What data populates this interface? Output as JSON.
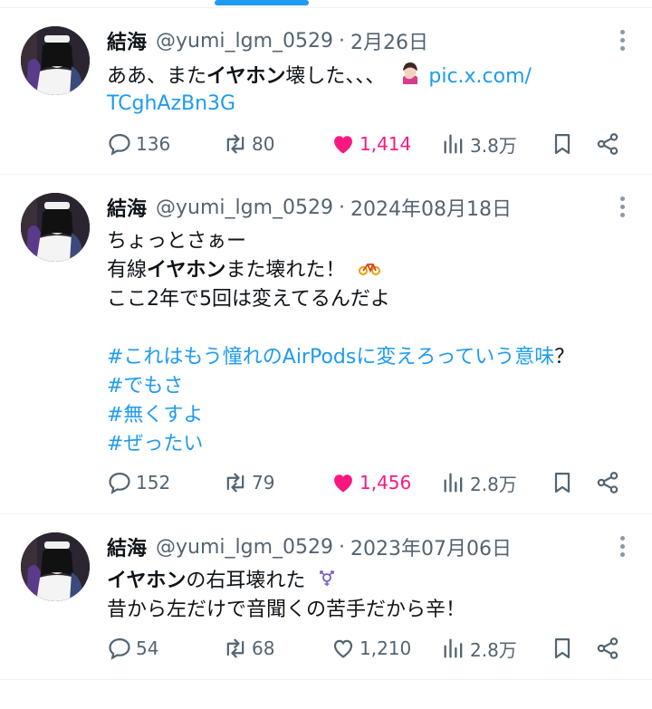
{
  "tweets": [
    {
      "name": "結海",
      "handle": "@yumi_lgm_0529",
      "separator": "·",
      "date": "2月26日",
      "text": {
        "line1_pre": "ああ、また",
        "line1_bold": "イヤホン",
        "line1_post": "壊した、、、",
        "link_part1": "pic.x.com/",
        "link_part2": "TCghAzBn3G"
      },
      "emoji": "woman-facepalming-emoji",
      "stats": {
        "replies": "136",
        "retweets": "80",
        "likes": "1,414",
        "views": "3.8万"
      },
      "liked": true
    },
    {
      "name": "結海",
      "handle": "@yumi_lgm_0529",
      "separator": "·",
      "date": "2024年08月18日",
      "text": {
        "line1": "ちょっとさぁー",
        "line2_pre": "有線",
        "line2_bold": "イヤホン",
        "line2_post": "また壊れた！",
        "line3": "ここ2年で5回は変えてるんだよ",
        "hashtag1": "#これはもう憧れのAirPodsに変えろっていう意味",
        "hashtag1_suffix": "？",
        "hashtag2": "#でもさ",
        "hashtag3": "#無くすよ",
        "hashtag4": "#ぜったい"
      },
      "emoji": "bicycle-emoji",
      "stats": {
        "replies": "152",
        "retweets": "79",
        "likes": "1,456",
        "views": "2.8万"
      },
      "liked": true
    },
    {
      "name": "結海",
      "handle": "@yumi_lgm_0529",
      "separator": "·",
      "date": "2023年07月06日",
      "text": {
        "line1_bold": "イヤホン",
        "line1_post": "の右耳壊れた",
        "line2": "昔から左だけで音聞くの苦手だから辛！"
      },
      "emoji": "gender-symbol-emoji",
      "stats": {
        "replies": "54",
        "retweets": "68",
        "likes": "1,210",
        "views": "2.8万"
      },
      "liked": false
    }
  ],
  "colors": {
    "accent": "#1d9bf0",
    "like": "#f91880",
    "muted": "#536471",
    "text": "#0f1419"
  }
}
